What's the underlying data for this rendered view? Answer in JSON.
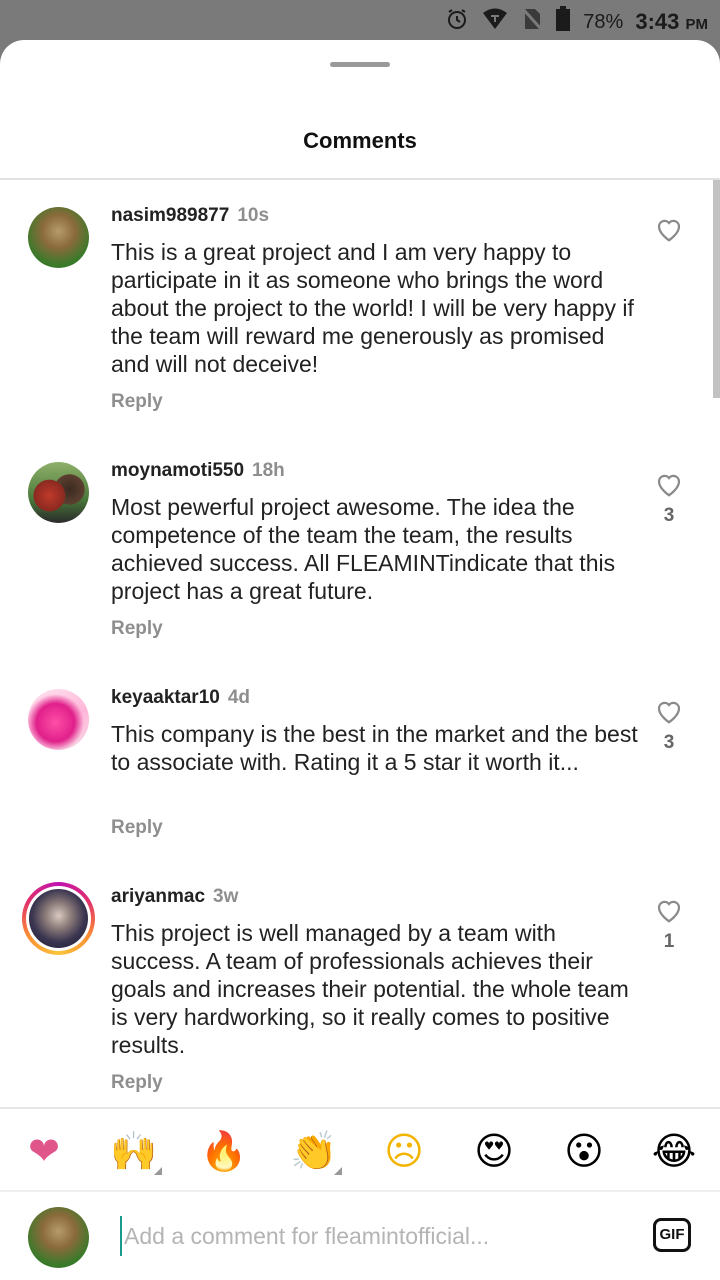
{
  "status": {
    "battery": "78%",
    "time": "3:43",
    "ampm": "PM"
  },
  "sheet": {
    "title": "Comments"
  },
  "comments": [
    {
      "username": "nasim989877",
      "age": "10s",
      "text": "This is a great project and I am very happy to participate in it as someone who brings the word about the project to the world! I will be very happy if the team will reward me generously as promised and will not deceive!",
      "reply_label": "Reply",
      "likes": ""
    },
    {
      "username": "moynamoti550",
      "age": "18h",
      "text": "Most pewerful project awesome. The idea the competence of the team the team, the results achieved success. All FLEAMINTindicate that this project has a great future.",
      "reply_label": "Reply",
      "likes": "3"
    },
    {
      "username": "keyaaktar10",
      "age": "4d",
      "text": "This company is the best in the market and the best to associate with. Rating it a 5 star it worth it...",
      "reply_label": "Reply",
      "likes": "3"
    },
    {
      "username": "ariyanmac",
      "age": "3w",
      "text": "This project is well managed by a team with success. A team of professionals achieves their goals and increases their potential. the whole team is very hardworking, so it really comes to positive results.",
      "reply_label": "Reply",
      "likes": "1"
    }
  ],
  "emoji_bar": [
    {
      "name": "heart-emoji",
      "glyph": "❤"
    },
    {
      "name": "raised-hands-emoji",
      "glyph": "🙌"
    },
    {
      "name": "fire-emoji",
      "glyph": "🔥"
    },
    {
      "name": "clapping-hands-emoji",
      "glyph": "👏"
    },
    {
      "name": "sad-face-emoji",
      "glyph": "☹"
    },
    {
      "name": "heart-eyes-emoji",
      "glyph": "😍"
    },
    {
      "name": "surprised-face-emoji",
      "glyph": "😮"
    },
    {
      "name": "laughing-face-emoji",
      "glyph": "😂"
    }
  ],
  "composer": {
    "placeholder": "Add a comment for fleamintofficial...",
    "gif_label": "GIF"
  },
  "colors": {
    "heart": "#e0558a",
    "accent_cursor": "#1a9a8a",
    "muted": "#8e8e8e"
  }
}
